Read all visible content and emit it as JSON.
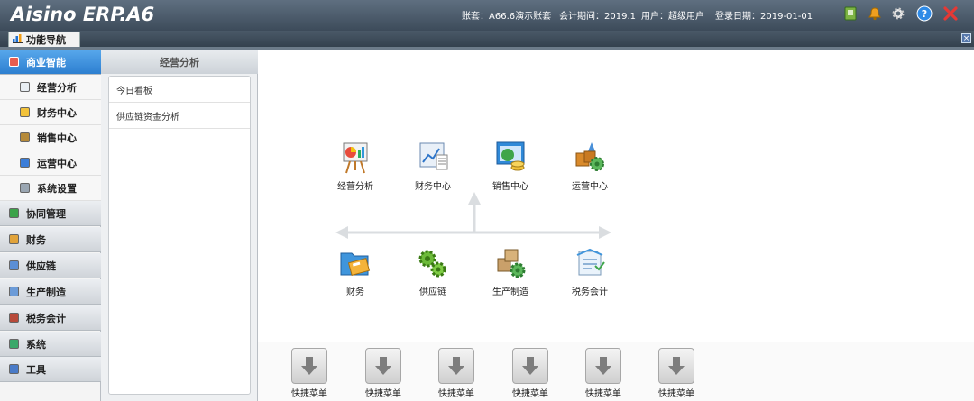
{
  "app": {
    "logo": "Aisino ERP.A6",
    "account": "账套：A66.6演示账套",
    "period": "会计期间：2019.1",
    "user": "用户：超级用户",
    "login_date": "登录日期：2019-01-01"
  },
  "tab": {
    "label": "功能导航"
  },
  "sidebar": {
    "items": [
      {
        "label": "商业智能",
        "icon": "bi-icon",
        "kind": "category",
        "active": true
      },
      {
        "label": "经营分析",
        "icon": "analysis-icon",
        "kind": "sub"
      },
      {
        "label": "财务中心",
        "icon": "finance-center-icon",
        "kind": "sub"
      },
      {
        "label": "销售中心",
        "icon": "sales-center-icon",
        "kind": "sub"
      },
      {
        "label": "运营中心",
        "icon": "operation-center-icon",
        "kind": "sub"
      },
      {
        "label": "系统设置",
        "icon": "system-settings-icon",
        "kind": "sub"
      },
      {
        "label": "协同管理",
        "icon": "collaboration-icon",
        "kind": "category"
      },
      {
        "label": "财务",
        "icon": "finance-icon",
        "kind": "category"
      },
      {
        "label": "供应链",
        "icon": "supply-chain-icon",
        "kind": "category"
      },
      {
        "label": "生产制造",
        "icon": "manufacturing-icon",
        "kind": "category"
      },
      {
        "label": "税务会计",
        "icon": "tax-accounting-icon",
        "kind": "category"
      },
      {
        "label": "系统",
        "icon": "system-icon",
        "kind": "category"
      },
      {
        "label": "工具",
        "icon": "tools-icon",
        "kind": "category"
      }
    ]
  },
  "submenu": {
    "title": "经营分析",
    "items": [
      "今日看板",
      "供应链资金分析"
    ]
  },
  "main": {
    "top_row": [
      "经营分析",
      "财务中心",
      "销售中心",
      "运营中心"
    ],
    "bottom_row": [
      "财务",
      "供应链",
      "生产制造",
      "税务会计"
    ]
  },
  "quickbar": {
    "items": [
      "快捷菜单",
      "快捷菜单",
      "快捷菜单",
      "快捷菜单",
      "快捷菜单",
      "快捷菜单"
    ]
  },
  "colors": {
    "active_nav": "#2d7fd0",
    "title_bar": "#4a5968",
    "flow_arrow": "#dadde0"
  }
}
